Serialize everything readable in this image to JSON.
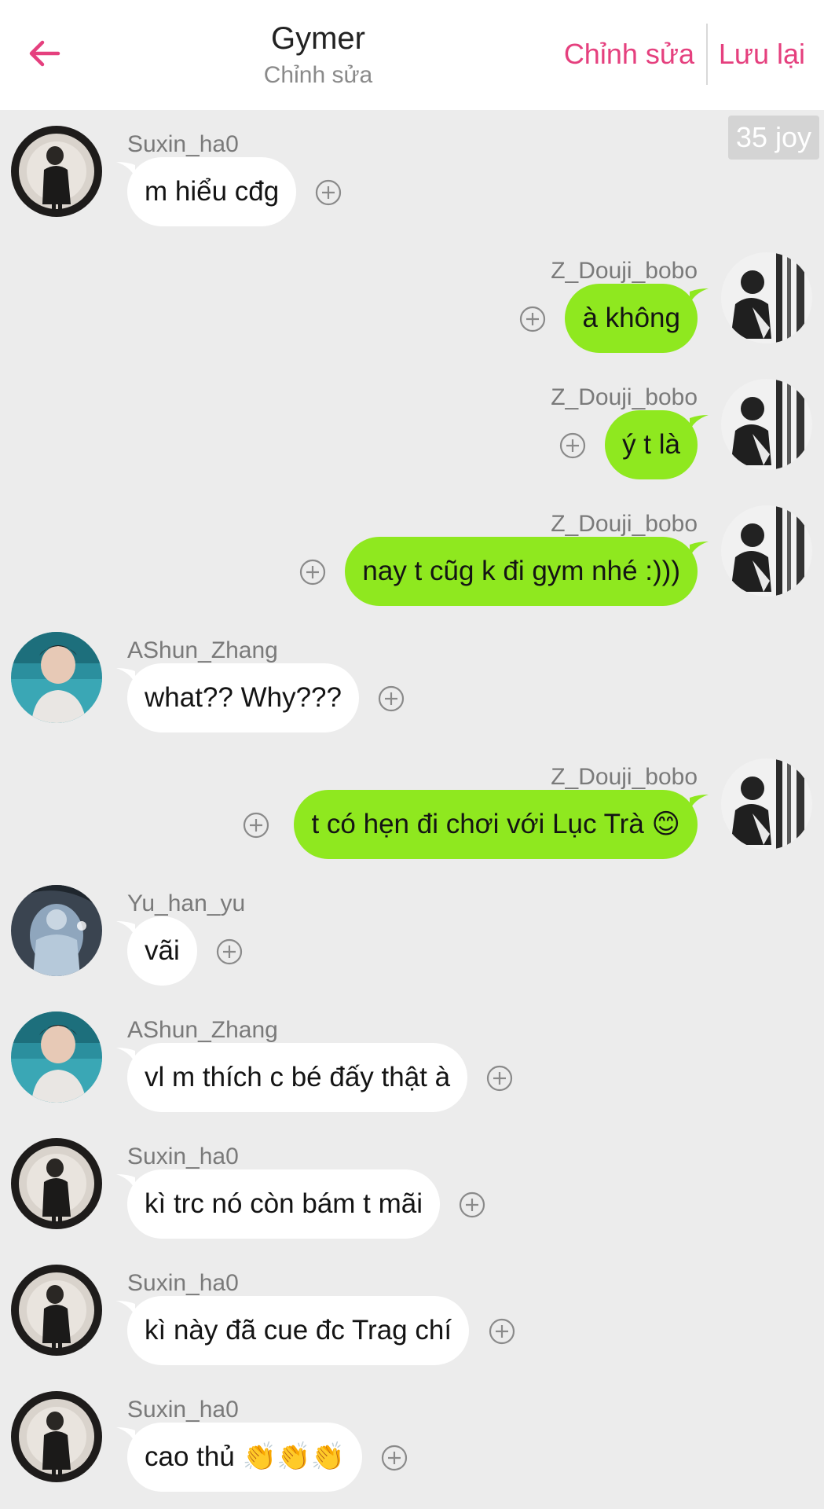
{
  "header": {
    "title": "Gymer",
    "subtitle": "Chỉnh sửa",
    "edit_label": "Chỉnh sửa",
    "save_label": "Lưu lại",
    "back_icon": "arrow-left-icon"
  },
  "joy_badge": "35 joy",
  "colors": {
    "accent": "#e5407e",
    "own_bubble": "#8fe81f",
    "other_bubble": "#ffffff",
    "background": "#ececec"
  },
  "messages": [
    {
      "side": "left",
      "sender": "Suxin_ha0",
      "text": "m hiểu cđg",
      "avatar": "avatar-suxin"
    },
    {
      "side": "right",
      "sender": "Z_Douji_bobo",
      "text": "à không",
      "avatar": "avatar-zdouji"
    },
    {
      "side": "right",
      "sender": "Z_Douji_bobo",
      "text": "ý t là",
      "avatar": "avatar-zdouji"
    },
    {
      "side": "right",
      "sender": "Z_Douji_bobo",
      "text": "nay t cũg k đi gym nhé :)))",
      "avatar": "avatar-zdouji"
    },
    {
      "side": "left",
      "sender": "AShun_Zhang",
      "text": "what?? Why???",
      "avatar": "avatar-ashun"
    },
    {
      "side": "right",
      "sender": "Z_Douji_bobo",
      "text": "t có hẹn đi chơi với Lục Trà 😊",
      "avatar": "avatar-zdouji"
    },
    {
      "side": "left",
      "sender": "Yu_han_yu",
      "text": "vãi",
      "avatar": "avatar-yuhan"
    },
    {
      "side": "left",
      "sender": "AShun_Zhang",
      "text": "vl m thích c bé đấy thật à",
      "avatar": "avatar-ashun"
    },
    {
      "side": "left",
      "sender": "Suxin_ha0",
      "text": "kì trc nó còn bám t mãi",
      "avatar": "avatar-suxin"
    },
    {
      "side": "left",
      "sender": "Suxin_ha0",
      "text": "kì này đã cue đc Trag chí",
      "avatar": "avatar-suxin"
    },
    {
      "side": "left",
      "sender": "Suxin_ha0",
      "text": "cao thủ 👏👏👏",
      "avatar": "avatar-suxin"
    }
  ]
}
